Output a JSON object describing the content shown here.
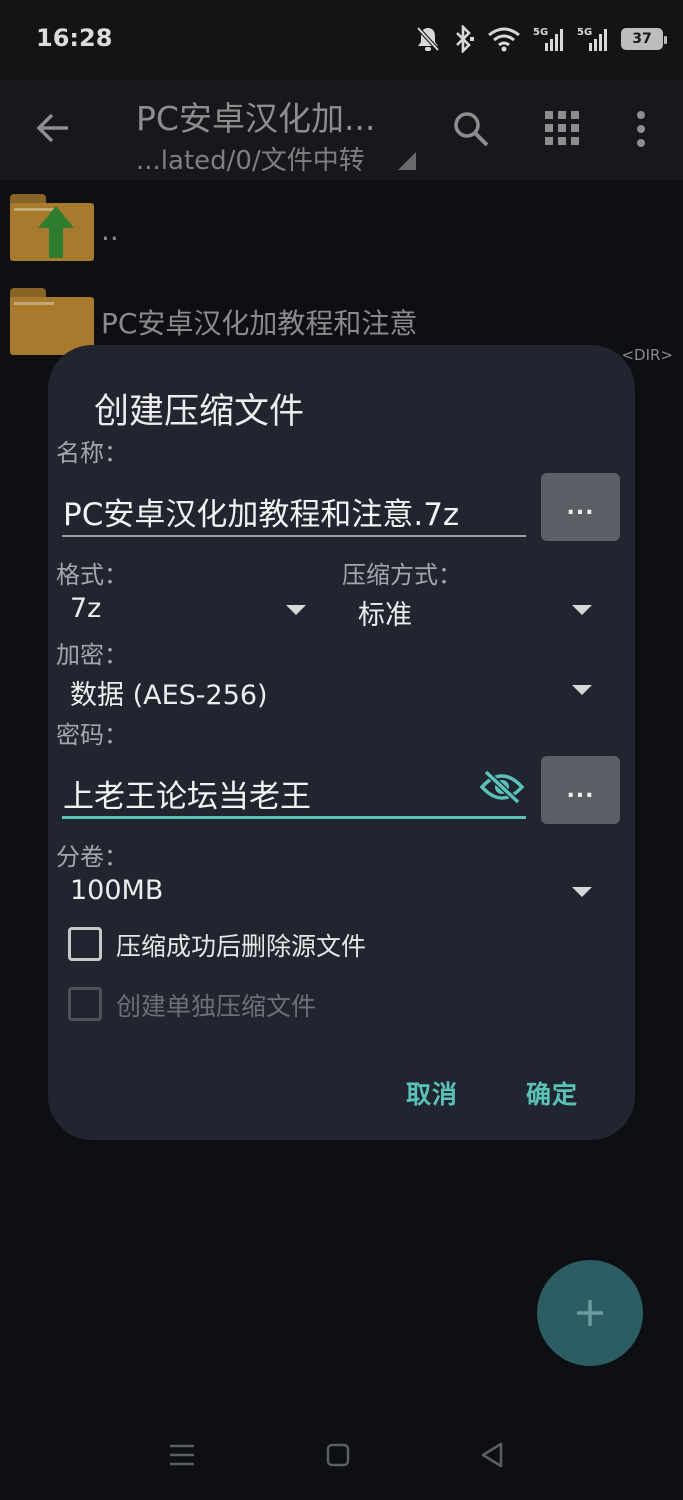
{
  "status_bar": {
    "time": "16:28",
    "battery_level": "37",
    "icons": [
      "mute-bell-icon",
      "bluetooth-icon",
      "wifi-icon",
      "signal-5g-icon",
      "signal-5g-icon",
      "battery-icon"
    ]
  },
  "app_bar": {
    "title": "PC安卓汉化加...",
    "subtitle": "...lated/0/文件中转",
    "icons": [
      "back-arrow-icon",
      "search-icon",
      "grid-view-icon",
      "more-vert-icon"
    ]
  },
  "file_list": {
    "items": [
      {
        "name": "..",
        "type": "parent-folder"
      },
      {
        "name": "PC安卓汉化加教程和注意",
        "type": "folder",
        "tag": "<DIR>"
      }
    ]
  },
  "dialog": {
    "title": "创建压缩文件",
    "name_label": "名称：",
    "name_value": "PC安卓汉化加教程和注意.7z",
    "browse_label": "...",
    "format_label": "格式：",
    "format_value": "7z",
    "method_label": "压缩方式：",
    "method_value": "标准",
    "encryption_label": "加密：",
    "encryption_value": "数据 (AES-256)",
    "password_label": "密码：",
    "password_value": "上老王论坛当老王",
    "password_more_label": "...",
    "split_label": "分卷：",
    "split_value": "100MB",
    "delete_source_label": "压缩成功后删除源文件",
    "delete_source_checked": false,
    "separate_archives_label": "创建单独压缩文件",
    "separate_archives_checked": false,
    "cancel_label": "取消",
    "ok_label": "确定",
    "accent_color": "#5bc2b7"
  },
  "fab": {
    "icon": "plus-icon"
  },
  "nav_bar": {
    "icons": [
      "menu-icon",
      "home-square-icon",
      "back-triangle-icon"
    ]
  }
}
